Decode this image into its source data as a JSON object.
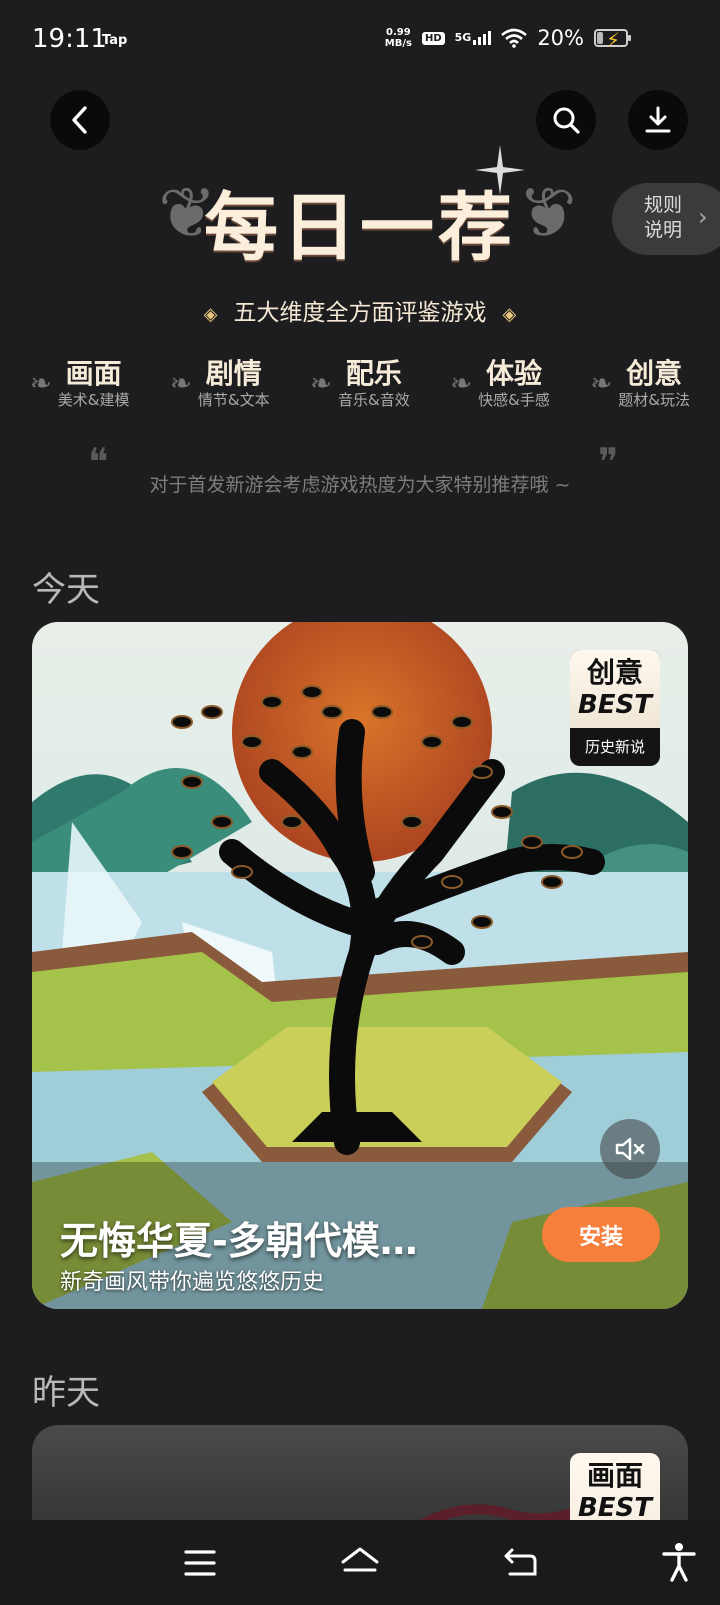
{
  "status_bar": {
    "time": "19:11",
    "app_indicator": "Tap",
    "net_speed_value": "0.99",
    "net_speed_unit": "MB/s",
    "hd": "HD",
    "network": "5G",
    "battery_percent": "20%",
    "battery_level": 0.2,
    "charging_icon": "bolt-icon"
  },
  "header": {
    "back_icon": "back-arrow-icon",
    "search_icon": "search-icon",
    "download_icon": "download-icon",
    "title": "每日一荐",
    "rules_line1": "规则",
    "rules_line2": "说明",
    "subtitle": "五大维度全方面评鉴游戏"
  },
  "dimensions": [
    {
      "main": "画面",
      "sub": "美术&建模"
    },
    {
      "main": "剧情",
      "sub": "情节&文本"
    },
    {
      "main": "配乐",
      "sub": "音乐&音效"
    },
    {
      "main": "体验",
      "sub": "快感&手感"
    },
    {
      "main": "创意",
      "sub": "题材&玩法"
    }
  ],
  "quote": "对于首发新游会考虑游戏热度为大家特别推荐哦 ~",
  "sections": {
    "today": "今天",
    "yesterday": "昨天"
  },
  "today_card": {
    "badge_line1": "创意",
    "badge_line2": "BEST",
    "badge_caption": "历史新说",
    "game_name": "无悔华夏-多朝代模…",
    "game_desc": "新奇画风带你遍览悠悠历史",
    "install_label": "安装",
    "mute_icon": "volume-muted-icon"
  },
  "yesterday_card": {
    "badge_line1": "画面",
    "badge_line2": "BEST"
  },
  "nav_bar": {
    "menu_icon": "menu-icon",
    "home_icon": "home-icon",
    "back_icon": "return-icon",
    "accessibility_icon": "accessibility-icon"
  },
  "colors": {
    "background": "#1d1d1f",
    "accent": "#f57f3b",
    "title": "#fbeedb"
  }
}
